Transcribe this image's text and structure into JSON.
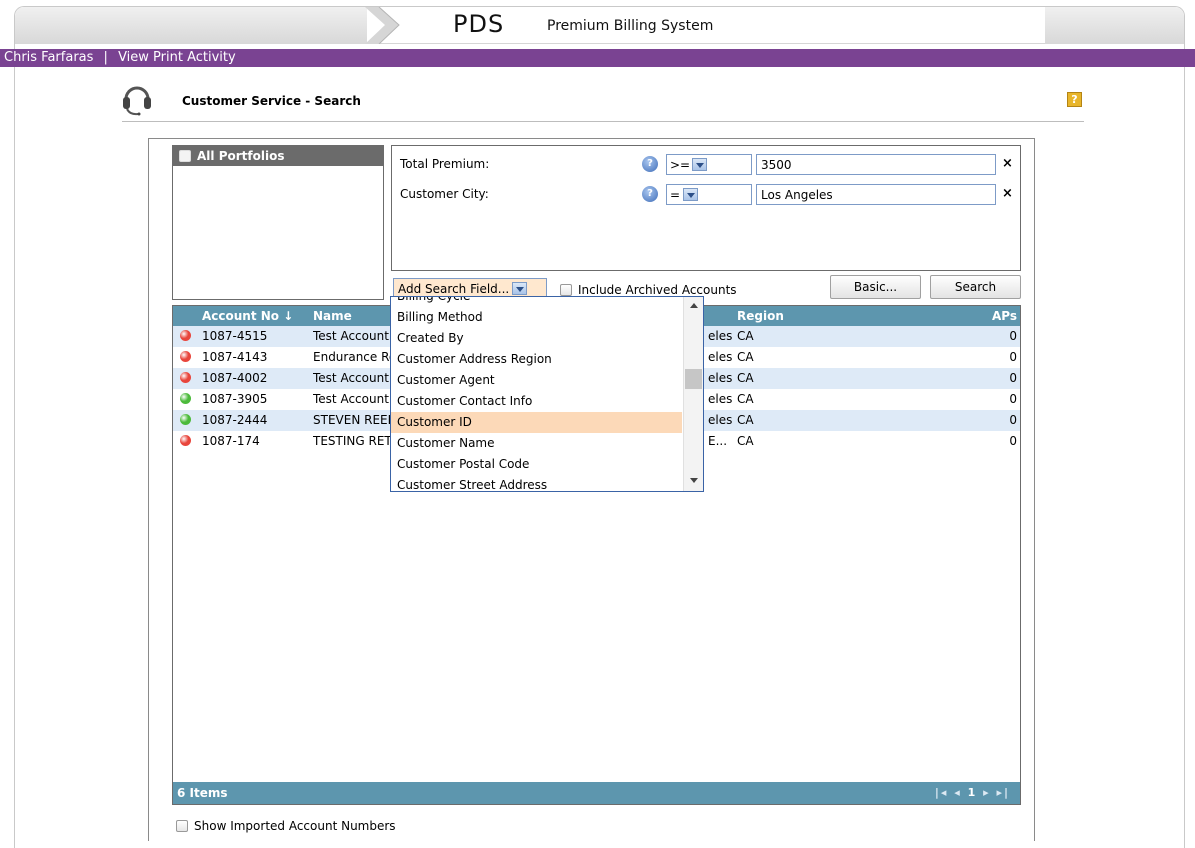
{
  "app": {
    "logo": "PDS",
    "title": "Premium Billing System"
  },
  "userbar": {
    "user_name": "Chris Farfaras",
    "separator": "|",
    "print_activity": "View Print Activity"
  },
  "page": {
    "title": "Customer Service - Search",
    "help_label": "?"
  },
  "portfolios": {
    "label": "All Portfolios"
  },
  "criteria": [
    {
      "label": "Total Premium:",
      "operator": ">=",
      "value": "3500",
      "help": "?",
      "remove": "×"
    },
    {
      "label": "Customer City:",
      "operator": "=",
      "value": "Los Angeles",
      "help": "?",
      "remove": "×"
    }
  ],
  "toolbar": {
    "add_field": "Add Search Field...",
    "include_archived": "Include Archived Accounts",
    "basic": "Basic...",
    "search": "Search"
  },
  "grid": {
    "columns": {
      "account_no": "Account No",
      "sort_arrow": "↓",
      "name": "Name",
      "region": "Region",
      "aps": "APs"
    },
    "rows": [
      {
        "status": "red",
        "account_no": "1087-4515",
        "name": "Test Account",
        "city": "eles",
        "region": "CA",
        "aps": "0"
      },
      {
        "status": "red",
        "account_no": "1087-4143",
        "name": "Endurance Ro",
        "city": "eles",
        "region": "CA",
        "aps": "0"
      },
      {
        "status": "red",
        "account_no": "1087-4002",
        "name": "Test Account",
        "city": "eles",
        "region": "CA",
        "aps": "0"
      },
      {
        "status": "green",
        "account_no": "1087-3905",
        "name": "Test Account",
        "city": "eles",
        "region": "CA",
        "aps": "0"
      },
      {
        "status": "green",
        "account_no": "1087-2444",
        "name": "STEVEN REED",
        "city": "eles",
        "region": "CA",
        "aps": "0"
      },
      {
        "status": "red",
        "account_no": "1087-174",
        "name": "TESTING RET",
        "city": "E...",
        "region": "CA",
        "aps": "0"
      }
    ],
    "footer": {
      "count": "6 Items",
      "first": "|◂",
      "prev": "◂",
      "page": "1",
      "next": "▸",
      "last": "▸|"
    }
  },
  "show_imported": "Show Imported Account Numbers",
  "dropdown": {
    "items": [
      {
        "label": "Billing Cycle",
        "selected": false
      },
      {
        "label": "Billing Method",
        "selected": false
      },
      {
        "label": "Created By",
        "selected": false
      },
      {
        "label": "Customer Address Region",
        "selected": false
      },
      {
        "label": "Customer Agent",
        "selected": false
      },
      {
        "label": "Customer Contact Info",
        "selected": false
      },
      {
        "label": "Customer ID",
        "selected": true
      },
      {
        "label": "Customer Name",
        "selected": false
      },
      {
        "label": "Customer Postal Code",
        "selected": false
      },
      {
        "label": "Customer Street Address",
        "selected": false
      }
    ]
  },
  "colors": {
    "purple_bar": "#7a4392",
    "grid_header": "#5d96ae",
    "row_alt": "#deeaf7",
    "status_red": "#e8453c",
    "status_green": "#4cba3b",
    "dropdown_selected": "#fcd9b8"
  }
}
